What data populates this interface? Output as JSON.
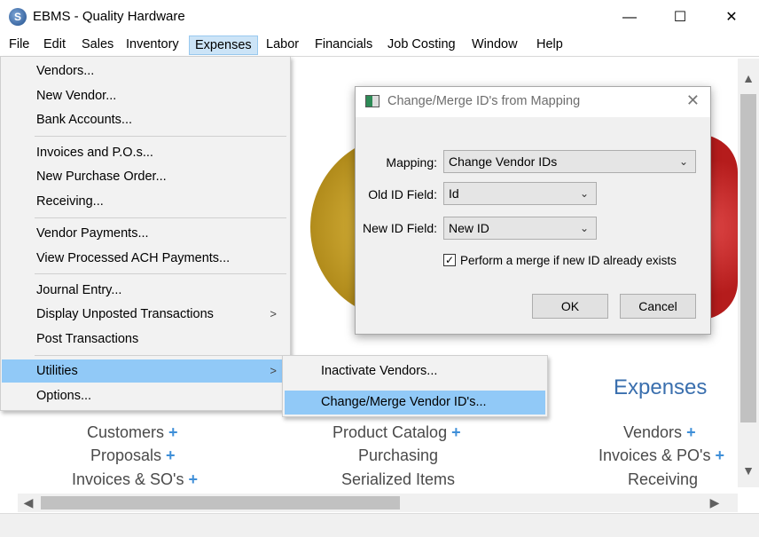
{
  "window": {
    "title": "EBMS - Quality Hardware",
    "app_icon": "S",
    "min": "—",
    "max": "☐",
    "close": "✕"
  },
  "menubar": [
    "File",
    "Edit",
    "Sales",
    "Inventory",
    "Expenses",
    "Labor",
    "Financials",
    "Job Costing",
    "Window",
    "Help"
  ],
  "expenses_menu": {
    "vendors": "Vendors...",
    "new_vendor": "New Vendor...",
    "bank_accounts": "Bank Accounts...",
    "invoices_pos": "Invoices and P.O.s...",
    "new_po": "New Purchase Order...",
    "receiving": "Receiving...",
    "vendor_payments": "Vendor Payments...",
    "view_ach": "View Processed ACH Payments...",
    "journal_entry": "Journal Entry...",
    "display_unposted": "Display Unposted Transactions",
    "post_transactions": "Post Transactions",
    "utilities": "Utilities",
    "options": "Options..."
  },
  "utilities_submenu": {
    "inactivate": "Inactivate Vendors...",
    "change_merge": "Change/Merge Vendor ID's..."
  },
  "dialog": {
    "title": "Change/Merge ID's from Mapping",
    "mapping_label": "Mapping:",
    "mapping_value": "Change Vendor IDs",
    "old_label": "Old ID Field:",
    "old_value": "Id",
    "new_label": "New ID Field:",
    "new_value": "New ID",
    "merge_label": "Perform a merge if new ID already exists",
    "merge_checked": true,
    "ok": "OK",
    "cancel": "Cancel"
  },
  "background": {
    "section_title": "Expenses",
    "links": {
      "customers": "Customers",
      "proposals": "Proposals",
      "invoices_sos": "Invoices & SO's",
      "product_catalog": "Product Catalog",
      "purchasing": "Purchasing",
      "serialized": "Serialized Items",
      "vendors": "Vendors",
      "invoices_pos": "Invoices & PO's",
      "receiving": "Receiving"
    },
    "plus": "+"
  },
  "colors": {
    "accent": "#91c9f7",
    "section_title": "#3a6fae",
    "plus": "#3f8fd8"
  }
}
